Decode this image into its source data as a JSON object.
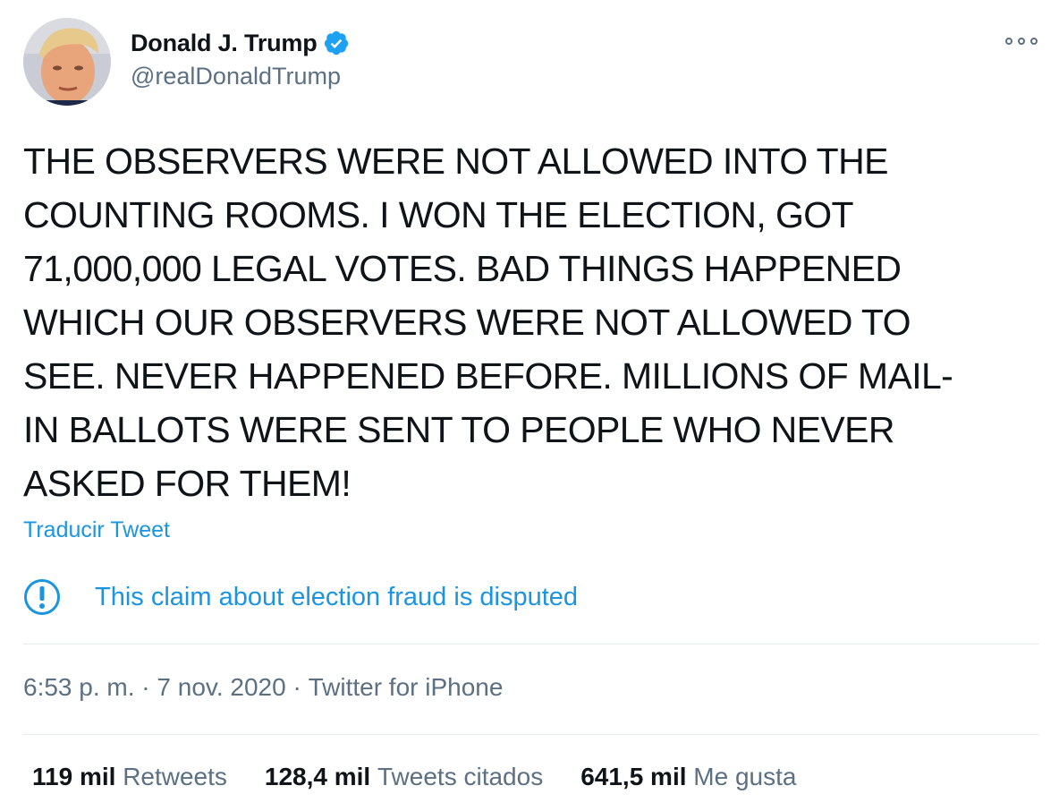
{
  "user": {
    "display_name": "Donald J. Trump",
    "handle": "@realDonaldTrump",
    "verified_icon": "verified-badge-icon"
  },
  "tweet": {
    "lines": [
      "THE OBSERVERS WERE NOT ALLOWED INTO THE",
      "COUNTING ROOMS. I WON THE ELECTION, GOT",
      "71,000,000 LEGAL VOTES. BAD THINGS HAPPENED",
      "WHICH OUR OBSERVERS WERE NOT ALLOWED TO",
      "SEE. NEVER HAPPENED BEFORE. MILLIONS OF MAIL-",
      "IN BALLOTS WERE SENT TO PEOPLE WHO NEVER",
      "ASKED FOR THEM!"
    ],
    "translate_label": "Traducir Tweet",
    "notice": "This claim about election fraud is disputed",
    "time": "6:53 p. m.",
    "date": "7 nov. 2020",
    "source": "Twitter for iPhone",
    "separator": " · "
  },
  "stats": {
    "retweets": {
      "value": "119 mil",
      "label": "Retweets"
    },
    "quotes": {
      "value": "128,4 mil",
      "label": "Tweets citados"
    },
    "likes": {
      "value": "641,5 mil",
      "label": "Me gusta"
    }
  },
  "colors": {
    "accent": "#1b95e0",
    "verified": "#1da1f2",
    "muted": "#5b7083",
    "text": "#0f1419",
    "divider": "#e6ecf0"
  }
}
